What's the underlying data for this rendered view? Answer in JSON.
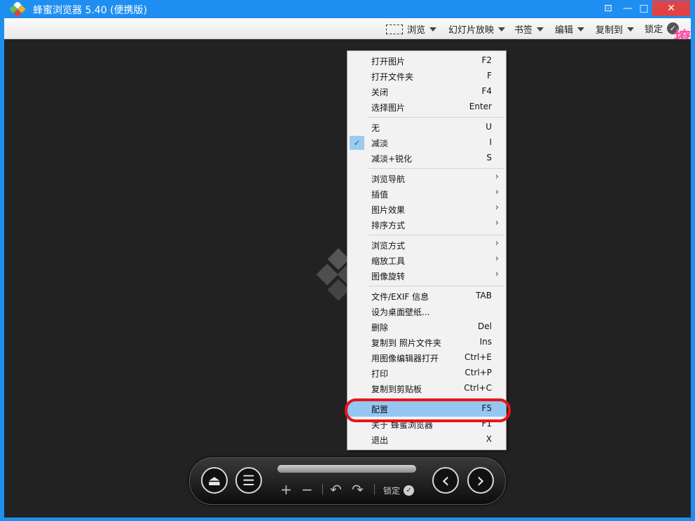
{
  "window": {
    "title": "蜂蜜浏览器 5.40 (便携版)",
    "compact_icon": "⊡",
    "min_icon": "—",
    "max_icon": "□",
    "close_icon": "✕"
  },
  "toolbar": {
    "browse": "浏览",
    "slideshow": "幻灯片放映",
    "bookmarks": "书签",
    "edit": "编辑",
    "copy_to": "复制到",
    "lock": "锁定",
    "lock_check": "✓",
    "corner_glyph": "撩"
  },
  "menu": {
    "items": [
      {
        "label": "打开图片",
        "shortcut": "F2"
      },
      {
        "label": "打开文件夹",
        "shortcut": "F"
      },
      {
        "label": "关闭",
        "shortcut": "F4"
      },
      {
        "label": "选择图片",
        "shortcut": "Enter"
      },
      {
        "label": "无",
        "shortcut": "U"
      },
      {
        "label": "减淡",
        "shortcut": "I",
        "checked": true
      },
      {
        "label": "减淡+锐化",
        "shortcut": "S"
      },
      {
        "label": "浏览导航",
        "submenu": true
      },
      {
        "label": "插值",
        "submenu": true
      },
      {
        "label": "图片效果",
        "submenu": true
      },
      {
        "label": "排序方式",
        "submenu": true
      },
      {
        "label": "浏览方式",
        "submenu": true
      },
      {
        "label": "缩放工具",
        "submenu": true
      },
      {
        "label": "图像旋转",
        "submenu": true
      },
      {
        "label": "文件/EXIF 信息",
        "shortcut": "TAB"
      },
      {
        "label": "设为桌面壁纸...",
        "shortcut": ""
      },
      {
        "label": "删除",
        "shortcut": "Del"
      },
      {
        "label": "复制到 照片文件夹",
        "shortcut": "Ins"
      },
      {
        "label": "用图像编辑器打开",
        "shortcut": "Ctrl+E"
      },
      {
        "label": "打印",
        "shortcut": "Ctrl+P"
      },
      {
        "label": "复制到剪贴板",
        "shortcut": "Ctrl+C"
      },
      {
        "label": "配置",
        "shortcut": "F5",
        "highlighted": true
      },
      {
        "label": "关于 蜂蜜浏览器",
        "shortcut": "F1"
      },
      {
        "label": "退出",
        "shortcut": "X"
      }
    ],
    "check_glyph": "✓",
    "submenu_glyph": "›"
  },
  "controls": {
    "eject_icon": "⏏",
    "menu_icon": "☰",
    "zoom_in": "+",
    "zoom_out": "−",
    "rotate_left": "↶",
    "rotate_right": "↷",
    "lock": "锁定",
    "lock_check": "✓",
    "prev_icon": "‹",
    "next_icon": "›"
  },
  "colors": {
    "titlebar": "#1f8ef1",
    "close_button": "#e04343",
    "menu_highlight": "#96c6f2",
    "callout": "#e8141c"
  }
}
